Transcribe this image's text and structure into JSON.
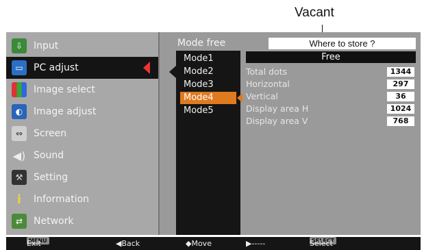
{
  "callout": {
    "label": "Vacant"
  },
  "menu": {
    "items": [
      {
        "label": "Input",
        "icon": "input-icon"
      },
      {
        "label": "PC adjust",
        "icon": "pc-monitor-icon",
        "selected": true
      },
      {
        "label": "Image select",
        "icon": "image-select-icon"
      },
      {
        "label": "Image adjust",
        "icon": "image-adjust-icon"
      },
      {
        "label": "Screen",
        "icon": "screen-icon"
      },
      {
        "label": "Sound",
        "icon": "speaker-icon"
      },
      {
        "label": "Setting",
        "icon": "setting-icon"
      },
      {
        "label": "Information",
        "icon": "information-icon"
      },
      {
        "label": "Network",
        "icon": "network-icon"
      }
    ]
  },
  "panel": {
    "title": "Mode free",
    "where_prompt": "Where to store ?",
    "free_label": "Free",
    "modes": [
      "Mode1",
      "Mode2",
      "Mode3",
      "Mode4",
      "Mode5"
    ],
    "active_mode": "Mode4",
    "params": [
      {
        "label": "Total dots",
        "value": "1344"
      },
      {
        "label": "Horizontal",
        "value": "297"
      },
      {
        "label": "Vertical",
        "value": "36"
      },
      {
        "label": "Display area H",
        "value": "1024"
      },
      {
        "label": "Display area V",
        "value": "768"
      }
    ]
  },
  "footer": {
    "exit_key": "MENU",
    "exit_label": "Exit",
    "back_label": "◀Back",
    "move_label": "◆Move",
    "dash_label": "▶-----",
    "select_key": "SELECT",
    "select_label": "Select"
  },
  "colors": {
    "accent_orange": "#e07a20",
    "selected_bg": "#141414",
    "menu_bg": "#a8a8a8",
    "arrow_red": "#ee3333"
  }
}
